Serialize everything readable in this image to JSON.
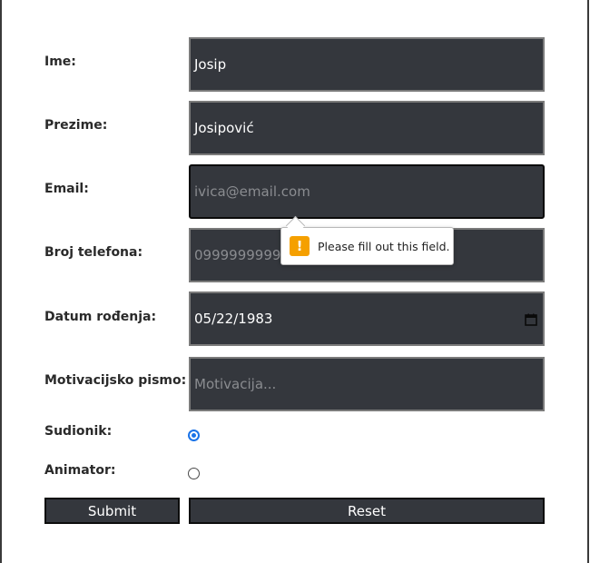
{
  "form": {
    "first_name": {
      "label": "Ime:",
      "value": "Josip"
    },
    "last_name": {
      "label": "Prezime:",
      "value": "Josipović"
    },
    "email": {
      "label": "Email:",
      "value": "",
      "placeholder": "ivica@email.com"
    },
    "phone": {
      "label": "Broj telefona:",
      "value": "",
      "placeholder": "0999999999"
    },
    "birth_date": {
      "label": "Datum rođenja:",
      "value": "05/22/1983"
    },
    "motivation": {
      "label": "Motivacijsko pismo:",
      "value": "",
      "placeholder": "Motivacija..."
    },
    "participant": {
      "label": "Sudionik:",
      "checked": true
    },
    "animator": {
      "label": "Animator:",
      "checked": false
    },
    "submit_label": "Submit",
    "reset_label": "Reset"
  },
  "validation_tooltip": {
    "message": "Please fill out this field.",
    "icon": "warning-icon",
    "icon_glyph": "!",
    "icon_color": "#f5a000"
  },
  "colors": {
    "field_background": "#34373d",
    "radio_accent": "#1a73e8"
  }
}
